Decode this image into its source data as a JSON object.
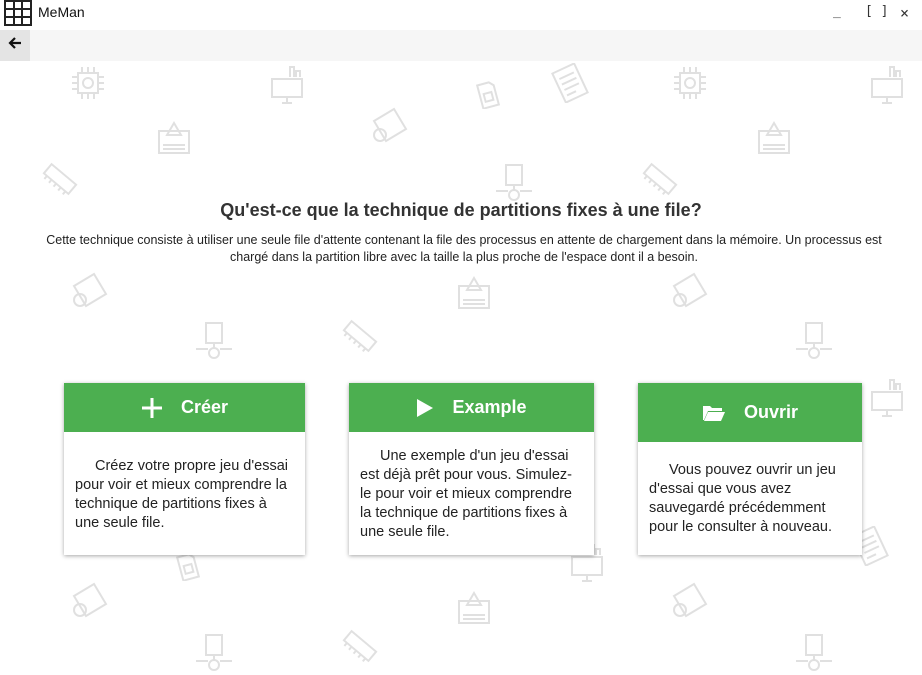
{
  "window": {
    "title": "MeMan",
    "minimize": "_",
    "maximize": "[ ]",
    "close": "×"
  },
  "nav": {
    "back_icon": "arrow-left-icon"
  },
  "heading": "Qu'est-ce que la technique de partitions fixes à une file?",
  "description": "Cette technique consiste à utiliser une seule file d'attente contenant la file des processus en attente de chargement dans la mémoire. Un processus est chargé dans la partition libre avec la taille la plus proche de l'espace dont il a besoin.",
  "cards": [
    {
      "label": "Créer",
      "icon": "plus-icon",
      "text": "Créez votre propre jeu d'essai pour voir et mieux comprendre la technique de partitions fixes à une seule file."
    },
    {
      "label": "Example",
      "icon": "play-icon",
      "text": "Une exemple d'un jeu d'essai est déjà prêt pour vous. Simulez-le pour voir et mieux comprendre la technique de partitions fixes à une seule file."
    },
    {
      "label": "Ouvrir",
      "icon": "folder-open-icon",
      "text": "Vous pouvez ouvrir un jeu d'essai que vous avez sauvegardé précédemment pour le consulter à nouveau."
    }
  ],
  "colors": {
    "accent": "#4caf50",
    "navbar": "#f6f6f6",
    "pattern": "#c8c8c8"
  }
}
